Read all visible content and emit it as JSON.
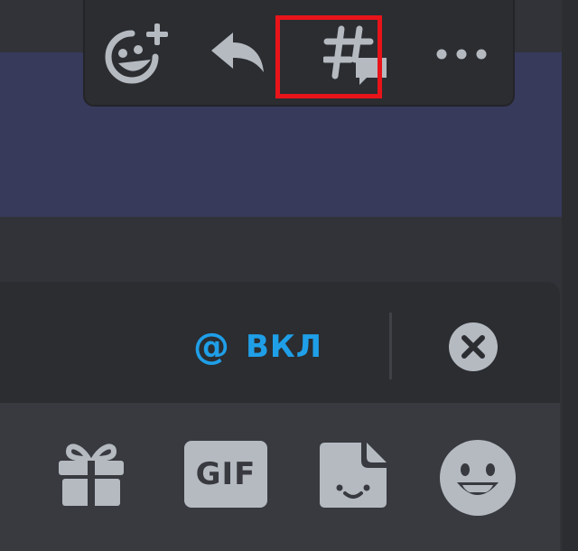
{
  "message_toolbar": {
    "items": [
      {
        "name": "add-reaction",
        "icon": "add-reaction-icon"
      },
      {
        "name": "reply",
        "icon": "reply-arrow-icon",
        "highlighted": true
      },
      {
        "name": "create-thread",
        "icon": "thread-icon"
      },
      {
        "name": "more",
        "icon": "more-dots-icon"
      }
    ],
    "highlight_color": "#e8141a"
  },
  "reply_bar": {
    "mention_symbol": "@",
    "mention_label": "ВКЛ",
    "mention_color": "#1f9fe8",
    "close_icon": "close-circle-icon"
  },
  "input_bar": {
    "gift_icon": "gift-icon",
    "gif_label": "GIF",
    "sticker_icon": "sticker-icon",
    "emoji_icon": "emoji-icon"
  },
  "colors": {
    "background": "#313338",
    "highlight_message": "#383a5c",
    "toolbar": "#2b2d31",
    "input": "#383a40",
    "icon": "#b5bac1"
  }
}
